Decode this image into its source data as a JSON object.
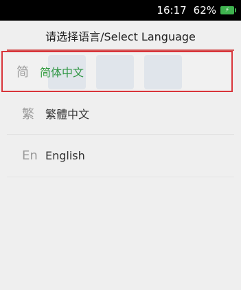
{
  "status_bar": {
    "time": "16:17",
    "battery_percent": "62%",
    "battery_color": "#3fb34f",
    "battery_symbol": "⚡"
  },
  "header": {
    "title": "请选择语言/Select Language",
    "accent_color": "#d35757"
  },
  "languages": [
    {
      "icon": "简",
      "label": "简体中文",
      "selected": true
    },
    {
      "icon": "繁",
      "label": "繁體中文",
      "selected": false
    },
    {
      "icon": "En",
      "label": "English",
      "selected": false
    }
  ],
  "colors": {
    "selected_text": "#2f9b3b",
    "selected_border": "#d9343a"
  }
}
